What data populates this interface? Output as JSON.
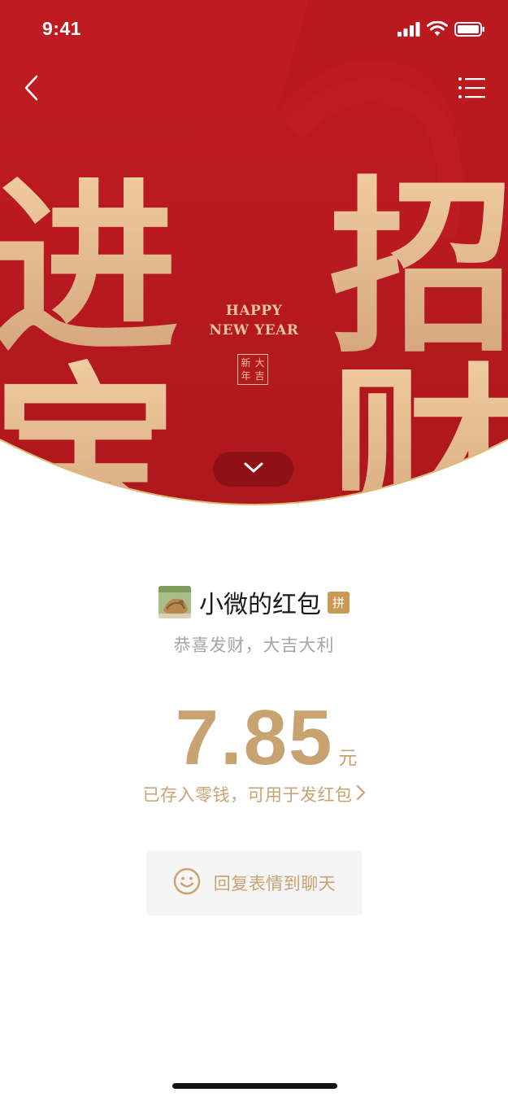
{
  "status_bar": {
    "time": "9:41",
    "icons": [
      "signal-icon",
      "wifi-icon",
      "battery-icon"
    ]
  },
  "navigation": {
    "back_icon": "chevron-left-icon",
    "menu_icon": "list-menu-icon"
  },
  "cover": {
    "big_characters_left": [
      "进",
      "宝"
    ],
    "big_characters_right": [
      "招",
      "财"
    ],
    "happy_line1": "HAPPY",
    "happy_line2": "NEW YEAR",
    "seal_characters": [
      "大",
      "新",
      "吉",
      "年"
    ],
    "expand_icon": "chevron-down-icon"
  },
  "sender": {
    "name": "小微的红包",
    "badge": "拼"
  },
  "blessing": "恭喜发财，大吉大利",
  "amount": {
    "value": "7.85",
    "unit": "元"
  },
  "deposit_link": "已存入零钱，可用于发红包",
  "reply_button": {
    "label": "回复表情到聊天",
    "icon": "smiley-icon"
  },
  "colors": {
    "cover_red": "#b51a20",
    "gold_text": "#c9a271",
    "cover_gold": "#e3b88e",
    "badge_gold": "#c99b52"
  }
}
